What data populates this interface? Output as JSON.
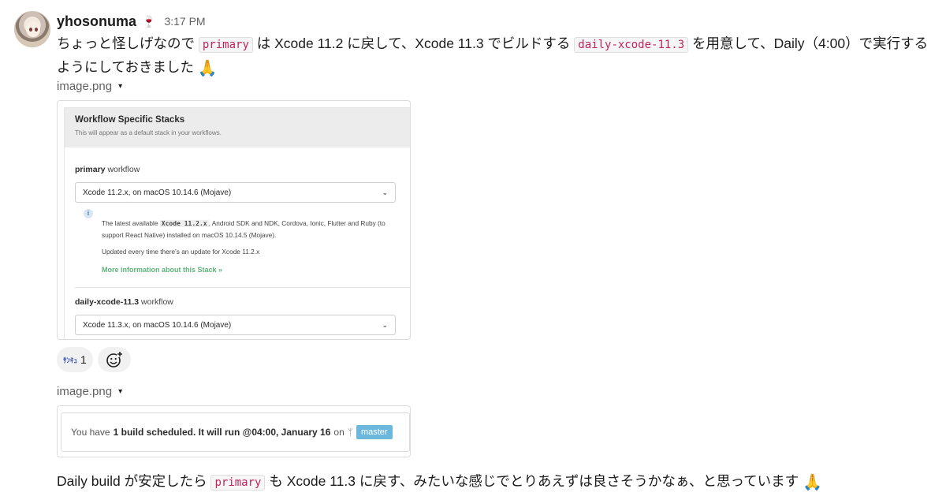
{
  "message": {
    "username": "yhosonuma",
    "status_emoji": "🍷",
    "timestamp": "3:17 PM",
    "text1_a": "ちょっと怪しげなので ",
    "code1": "primary",
    "text1_b": " は Xcode 11.2 に戻して、Xcode 11.3 でビルドする ",
    "code2": "daily-xcode-11.3",
    "text1_c": " を用意して、Daily（4:00）で実行するようにしておきました ",
    "emoji_pray": "🙏",
    "text2_a": "Daily build が安定したら ",
    "code3": "primary",
    "text2_b": " も Xcode 11.3 に戻す、みたいな感じでとりあえずは良さそうかなぁ、と思っています "
  },
  "attachment1": {
    "filename": "image.png",
    "caret": "▾",
    "panel_title": "Workflow Specific Stacks",
    "panel_subtitle": "This will appear as a default stack in your workflows.",
    "wf1_name": "primary",
    "wf1_suffix": " workflow",
    "wf1_select": "Xcode 11.2.x, on macOS 10.14.6 (Mojave)",
    "info_icon": "i",
    "info_prefix": "The latest available ",
    "info_code": "Xcode 11.2.x",
    "info_suffix": ", Android SDK and NDK, Cordova, Ionic, Flutter and Ruby (to support React Native) installed on macOS 10.14.5 (Mojave).",
    "info_updated": "Updated every time there's an update for Xcode 11.2.x",
    "info_link": "More information about this Stack »",
    "wf2_name": "daily-xcode-11.3",
    "wf2_suffix": " workflow",
    "wf2_select": "Xcode 11.3.x, on macOS 10.14.6 (Mojave)",
    "chevron": "⌄"
  },
  "reactions": {
    "reaction1_emoji": "ｻﾝｷｭ",
    "reaction1_count": "1"
  },
  "attachment2": {
    "filename": "image.png",
    "caret": "▾",
    "text_prefix": "You have ",
    "text_bold": "1 build scheduled. It will run @04:00, January 16",
    "text_on": " on ",
    "branch_icon": "ᛘ",
    "branch": "master"
  },
  "colors": {
    "code_text": "#c0245e",
    "link_green": "#5fb27b",
    "badge_blue": "#6cb7dd"
  }
}
